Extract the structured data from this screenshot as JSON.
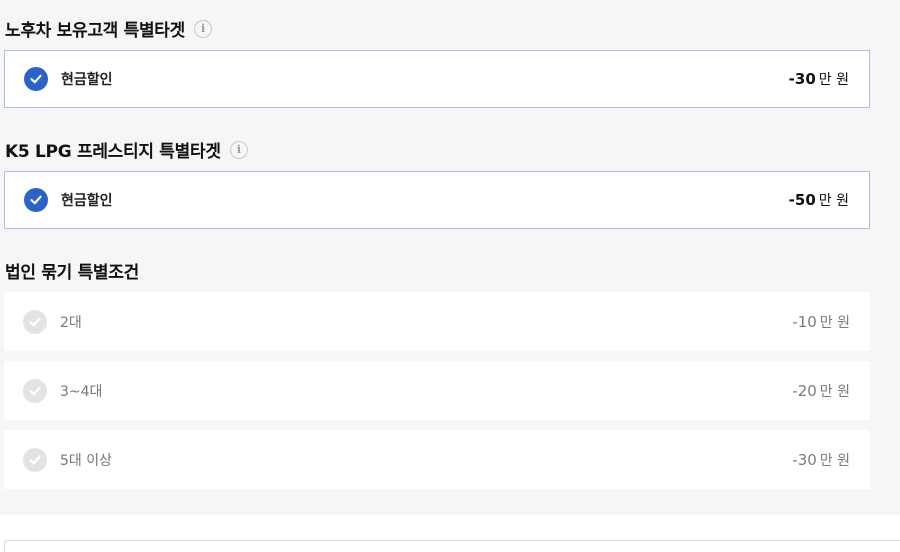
{
  "sections": [
    {
      "title": "노후차 보유고객 특별타겟",
      "options": [
        {
          "label": "현금할인",
          "amount": "-30",
          "unit": "만 원",
          "selected": true
        }
      ]
    },
    {
      "title": "K5 LPG 프레스티지 특별타겟",
      "options": [
        {
          "label": "현금할인",
          "amount": "-50",
          "unit": "만 원",
          "selected": true
        }
      ]
    },
    {
      "title": "법인 묶기 특별조건",
      "options": [
        {
          "label": "2대",
          "amount": "-10",
          "unit": "만 원",
          "selected": false
        },
        {
          "label": "3~4대",
          "amount": "-20",
          "unit": "만 원",
          "selected": false
        },
        {
          "label": "5대 이상",
          "amount": "-30",
          "unit": "만 원",
          "selected": false
        }
      ]
    }
  ],
  "info_icon_glyph": "i",
  "colors": {
    "accent": "#2b63c9",
    "selected_border": "#a9bee8",
    "disabled_check": "#e3e3e3",
    "background": "#f6f6f6"
  }
}
